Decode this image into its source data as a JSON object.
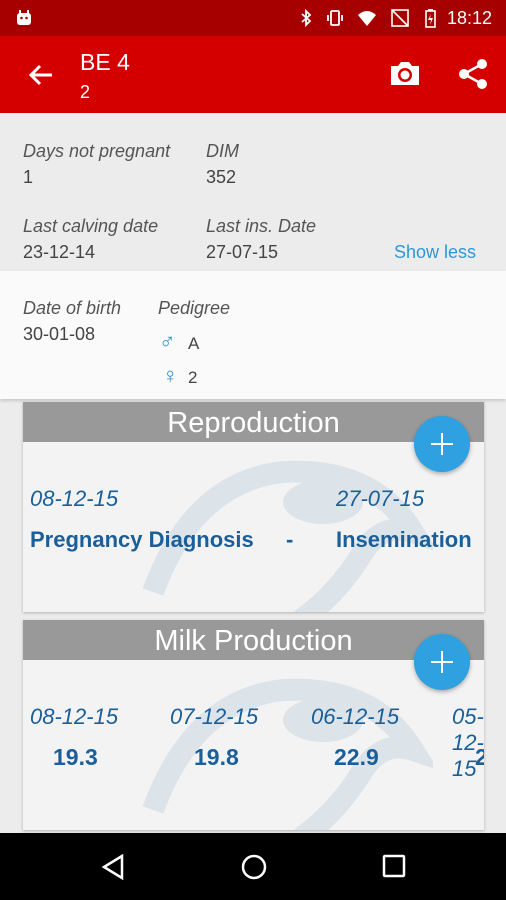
{
  "status_bar": {
    "time": "18:12"
  },
  "app_bar": {
    "title": "BE 4",
    "subtitle": "2"
  },
  "summary": {
    "days_not_pregnant_label": "Days not pregnant",
    "days_not_pregnant_value": "1",
    "dim_label": "DIM",
    "dim_value": "352",
    "last_calving_label": "Last calving date",
    "last_calving_value": "23-12-14",
    "last_ins_label": "Last ins. Date",
    "last_ins_value": "27-07-15",
    "show_less": "Show less"
  },
  "detail": {
    "dob_label": "Date of birth",
    "dob_value": "30-01-08",
    "pedigree_label": "Pedigree",
    "male_symbol": "♂",
    "male_value": "A",
    "female_symbol": "♀",
    "female_value": "2"
  },
  "reproduction": {
    "title": "Reproduction",
    "items": [
      {
        "date": "08-12-15",
        "event": "Pregnancy Diagnosis",
        "extra": "-"
      },
      {
        "date": "27-07-15",
        "event": "Insemination"
      }
    ]
  },
  "milk": {
    "title": "Milk Production",
    "items": [
      {
        "date": "08-12-15",
        "value": "19.3"
      },
      {
        "date": "07-12-15",
        "value": "19.8"
      },
      {
        "date": "06-12-15",
        "value": "22.9"
      },
      {
        "date": "05-12-15",
        "value": "2"
      }
    ]
  }
}
